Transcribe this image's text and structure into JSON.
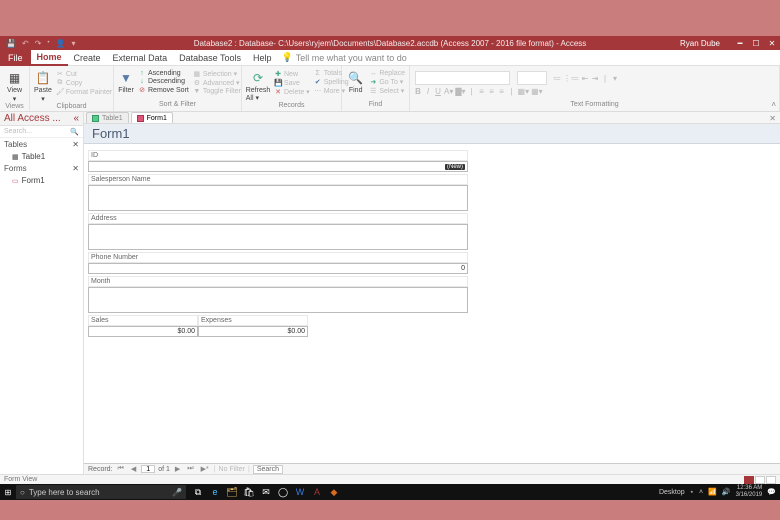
{
  "titlebar": {
    "title": "Database2 : Database- C:\\Users\\ryjem\\Documents\\Database2.accdb (Access 2007 - 2016 file format) - Access",
    "user": "Ryan Dube"
  },
  "menu": {
    "file": "File",
    "tabs": [
      "Home",
      "Create",
      "External Data",
      "Database Tools",
      "Help"
    ],
    "active": "Home",
    "tell": "Tell me what you want to do"
  },
  "ribbon": {
    "views": {
      "view": "View",
      "label": "Views"
    },
    "clipboard": {
      "paste": "Paste",
      "cut": "Cut",
      "copy": "Copy",
      "fmt": "Format Painter",
      "label": "Clipboard"
    },
    "sort": {
      "filter": "Filter",
      "asc": "Ascending",
      "desc": "Descending",
      "remove": "Remove Sort",
      "sel": "Selection ▾",
      "adv": "Advanced ▾",
      "toggle": "Toggle Filter",
      "label": "Sort & Filter"
    },
    "records": {
      "refresh": "Refresh All ▾",
      "new": "New",
      "save": "Save",
      "delete": "Delete ▾",
      "totals": "Totals",
      "spelling": "Spelling",
      "more": "More ▾",
      "label": "Records"
    },
    "find": {
      "find": "Find",
      "replace": "Replace",
      "goto": "Go To ▾",
      "select": "Select ▾",
      "label": "Find"
    },
    "textfmt": {
      "label": "Text Formatting"
    }
  },
  "nav": {
    "title": "All Access ...",
    "search": "Search...",
    "sections": [
      {
        "name": "Tables",
        "items": [
          {
            "label": "Table1"
          }
        ]
      },
      {
        "name": "Forms",
        "items": [
          {
            "label": "Form1"
          }
        ]
      }
    ]
  },
  "doctabs": [
    {
      "label": "Table1",
      "kind": "table",
      "active": false
    },
    {
      "label": "Form1",
      "kind": "form",
      "active": true
    }
  ],
  "form": {
    "title": "Form1",
    "fields": {
      "id": {
        "label": "ID",
        "value": "",
        "badge": "(New)"
      },
      "salesperson": {
        "label": "Salesperson Name",
        "value": ""
      },
      "address": {
        "label": "Address",
        "value": ""
      },
      "phone": {
        "label": "Phone Number",
        "value": "0"
      },
      "month": {
        "label": "Month",
        "value": ""
      },
      "sales": {
        "label": "Sales",
        "value": "$0.00"
      },
      "expenses": {
        "label": "Expenses",
        "value": "$0.00"
      }
    }
  },
  "recordnav": {
    "label": "Record:",
    "pos": "1",
    "of": "of 1",
    "nofilter": "No Filter",
    "search": "Search"
  },
  "status": {
    "view": "Form View"
  },
  "taskbar": {
    "search": "Type here to search",
    "desktop": "Desktop",
    "time": "12:36 AM",
    "date": "3/16/2019"
  }
}
